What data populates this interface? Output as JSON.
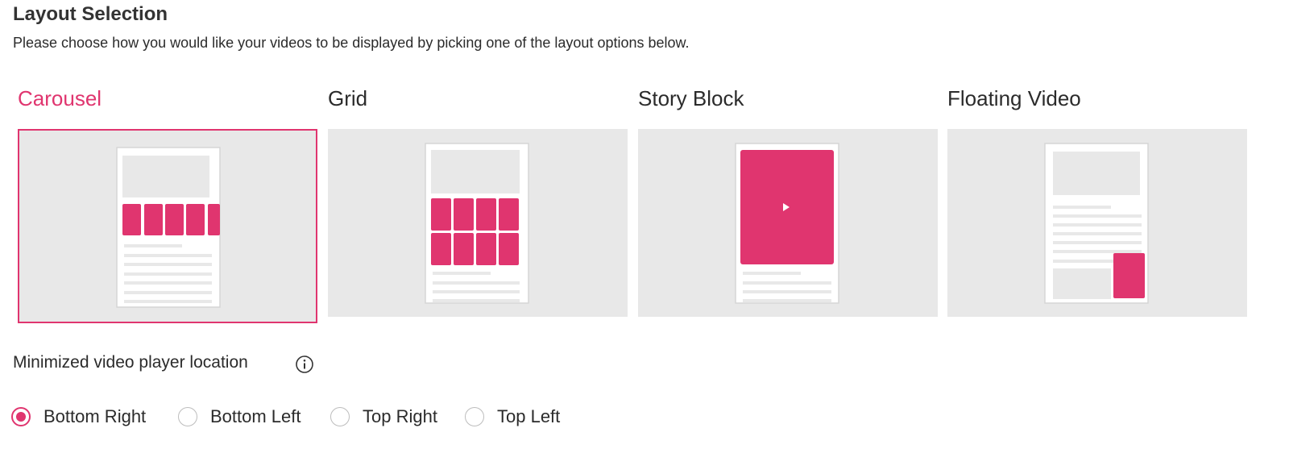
{
  "header": {
    "title": "Layout Selection",
    "subtitle": "Please choose how you would like your videos to be displayed by picking one of the layout options below."
  },
  "layouts": [
    {
      "label": "Carousel",
      "selected": true
    },
    {
      "label": "Grid",
      "selected": false
    },
    {
      "label": "Story Block",
      "selected": false
    },
    {
      "label": "Floating Video",
      "selected": false
    }
  ],
  "minimized": {
    "label": "Minimized video player location",
    "info_icon": "info-icon",
    "options": [
      {
        "label": "Bottom Right",
        "checked": true
      },
      {
        "label": "Bottom Left",
        "checked": false
      },
      {
        "label": "Top Right",
        "checked": false
      },
      {
        "label": "Top Left",
        "checked": false
      }
    ]
  },
  "colors": {
    "accent": "#e0356f",
    "preview_bg": "#e8e8e8",
    "text": "#2b2b2b"
  }
}
